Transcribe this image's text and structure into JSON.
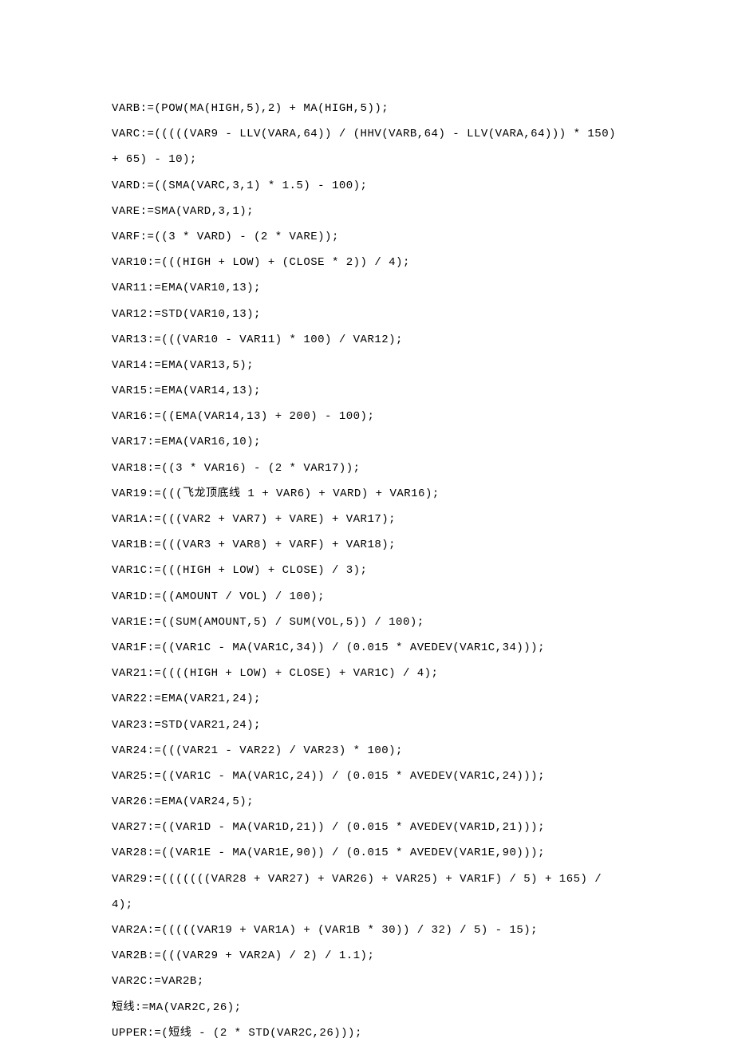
{
  "lines": [
    "VARB:=(POW(MA(HIGH,5),2) + MA(HIGH,5));",
    "VARC:=(((((VAR9 - LLV(VARA,64)) / (HHV(VARB,64) - LLV(VARA,64))) * 150) + 65) - 10);",
    "VARD:=((SMA(VARC,3,1) * 1.5) - 100);",
    "VARE:=SMA(VARD,3,1);",
    "VARF:=((3 * VARD) - (2 * VARE));",
    "VAR10:=(((HIGH + LOW) + (CLOSE * 2)) / 4);",
    "VAR11:=EMA(VAR10,13);",
    "VAR12:=STD(VAR10,13);",
    "VAR13:=(((VAR10 - VAR11) * 100) / VAR12);",
    "VAR14:=EMA(VAR13,5);",
    "VAR15:=EMA(VAR14,13);",
    "VAR16:=((EMA(VAR14,13) + 200) - 100);",
    "VAR17:=EMA(VAR16,10);",
    "VAR18:=((3 * VAR16) - (2 * VAR17));",
    "VAR19:=(((飞龙顶底线 1 + VAR6) + VARD) + VAR16);",
    "VAR1A:=(((VAR2 + VAR7) + VARE) + VAR17);",
    "VAR1B:=(((VAR3 + VAR8) + VARF) + VAR18);",
    "VAR1C:=(((HIGH + LOW) + CLOSE) / 3);",
    "VAR1D:=((AMOUNT / VOL) / 100);",
    "VAR1E:=((SUM(AMOUNT,5) / SUM(VOL,5)) / 100);",
    "VAR1F:=((VAR1C - MA(VAR1C,34)) / (0.015 * AVEDEV(VAR1C,34)));",
    "VAR21:=((((HIGH + LOW) + CLOSE) + VAR1C) / 4);",
    "VAR22:=EMA(VAR21,24);",
    "VAR23:=STD(VAR21,24);",
    "VAR24:=(((VAR21 - VAR22) / VAR23) * 100);",
    "VAR25:=((VAR1C - MA(VAR1C,24)) / (0.015 * AVEDEV(VAR1C,24)));",
    "VAR26:=EMA(VAR24,5);",
    "VAR27:=((VAR1D - MA(VAR1D,21)) / (0.015 * AVEDEV(VAR1D,21)));",
    "VAR28:=((VAR1E - MA(VAR1E,90)) / (0.015 * AVEDEV(VAR1E,90)));",
    "VAR29:=(((((((VAR28 + VAR27) + VAR26) + VAR25) + VAR1F) / 5) + 165) / 4);",
    "VAR2A:=(((((VAR19 + VAR1A) + (VAR1B * 30)) / 32) / 5) - 15);",
    "VAR2B:=(((VAR29 + VAR2A) / 2) / 1.1);",
    "VAR2C:=VAR2B;",
    "短线:=MA(VAR2C,26);",
    "UPPER:=(短线 - (2 * STD(VAR2C,26)));"
  ]
}
